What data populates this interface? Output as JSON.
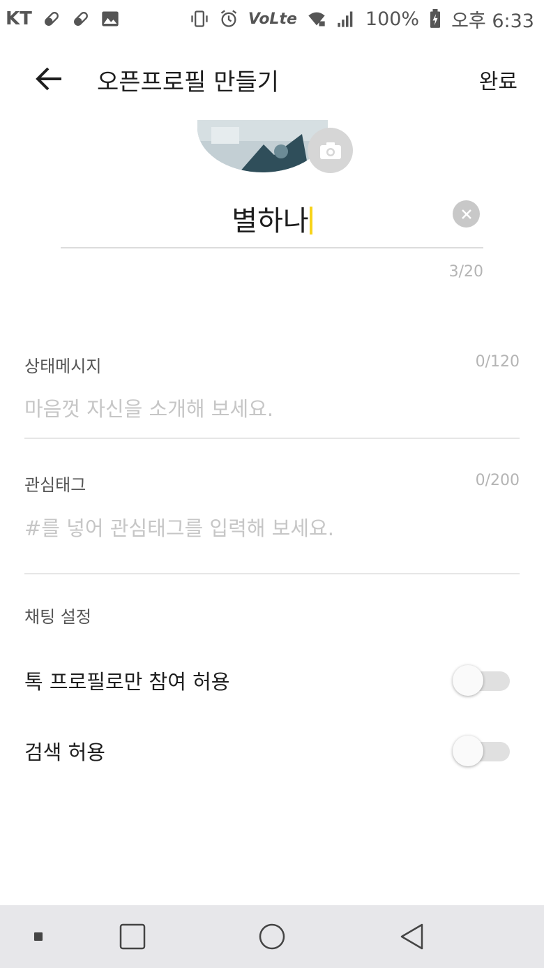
{
  "status_bar": {
    "carrier": "KT",
    "volte": "VoLte",
    "battery": "100%",
    "time": "오후 6:33",
    "icons": [
      "pill-icon",
      "pill-icon",
      "image-icon",
      "vibrate-icon",
      "alarm-icon",
      "volte-icon",
      "wifi-lock-icon",
      "signal-icon",
      "battery-charging-icon"
    ]
  },
  "header": {
    "back_icon": "arrow-left-icon",
    "title": "오픈프로필 만들기",
    "done_label": "완료"
  },
  "profile": {
    "camera_icon": "camera-icon",
    "name_value": "별하나",
    "name_count": "3/20",
    "clear_icon": "clear-circle-icon"
  },
  "status_message": {
    "label": "상태메시지",
    "count": "0/120",
    "placeholder": "마음껏 자신을 소개해 보세요.",
    "value": ""
  },
  "interest_tags": {
    "label": "관심태그",
    "count": "0/200",
    "placeholder": "#를 넣어 관심태그를 입력해 보세요.",
    "value": ""
  },
  "chat_settings": {
    "title": "채팅 설정",
    "options": [
      {
        "label": "톡 프로필로만 참여 허용",
        "enabled": false
      },
      {
        "label": "검색 허용",
        "enabled": false
      }
    ]
  },
  "nav_bar": {
    "icons": [
      "nav-dot-icon",
      "recent-apps-icon",
      "home-icon",
      "back-triangle-icon"
    ]
  },
  "colors": {
    "caret": "#f7d31a",
    "background": "#ffffff",
    "nav_bar": "#e7e7ea",
    "placeholder": "#c6c6c6"
  }
}
